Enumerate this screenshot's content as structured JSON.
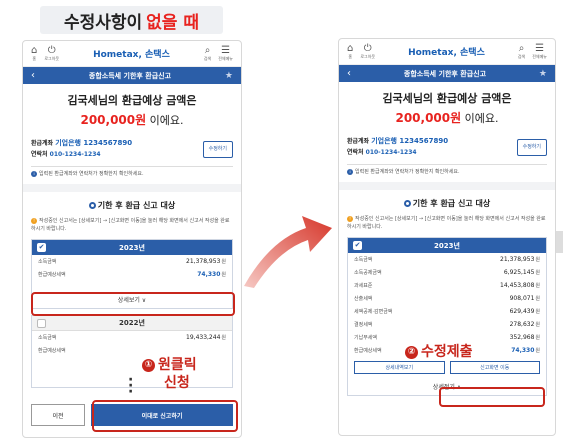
{
  "banner": {
    "text": "수정사항이",
    "highlight": "없을 때"
  },
  "app": {
    "home_label": "홈",
    "login_label": "로그아웃",
    "logo": "Hometax, 손택스",
    "search_label": "검색",
    "menu_label": "전체메뉴",
    "nav_title": "종합소득세 기한후 환급신고"
  },
  "greeting": {
    "name": "김국세",
    "line1": "님의 환급예상 금액은",
    "amount": "200,000원",
    "suffix": " 이에요."
  },
  "account": {
    "label_bank": "환급계좌",
    "bank": "기업은행 1234567890",
    "label_phone": "연락처",
    "phone": "010-1234-1234",
    "edit_btn": "수정하기",
    "notice": "입력된 환급계좌와 연락처가 정확한지 확인하세요."
  },
  "section": {
    "title": "기한 후 환급 신고 대상",
    "guide": "작성중인 신고서는 [상세보기] → [신고화면 이동]을 눌러 해당 화면에서 신고서 작성을 완료하시기 바랍니다."
  },
  "phone1": {
    "card1": {
      "year": "2023년",
      "rows": [
        {
          "label": "소득금액",
          "value": "21,378,953",
          "unit": "원"
        },
        {
          "label": "환급예상세액",
          "value": "74,330",
          "unit": "원"
        }
      ],
      "more": "상세보기 ∨"
    },
    "card2": {
      "year": "2022년",
      "rows": [
        {
          "label": "소득금액",
          "value": "19,433,244",
          "unit": "원"
        },
        {
          "label": "환급예상세액",
          "value": "",
          "unit": ""
        }
      ]
    },
    "btn_prev": "이전",
    "btn_submit": "이대로 신고하기"
  },
  "phone2": {
    "card1": {
      "year": "2023년",
      "rows": [
        {
          "label": "소득금액",
          "value": "21,378,953",
          "unit": "원"
        },
        {
          "label": "소득공제금액",
          "value": "6,925,145",
          "unit": "원"
        },
        {
          "label": "과세표준",
          "value": "14,453,808",
          "unit": "원"
        },
        {
          "label": "산출세액",
          "value": "908,071",
          "unit": "원"
        },
        {
          "label": "세액공제·감면금액",
          "value": "629,439",
          "unit": "원"
        },
        {
          "label": "결정세액",
          "value": "278,632",
          "unit": "원"
        },
        {
          "label": "기납부세액",
          "value": "352,968",
          "unit": "원"
        },
        {
          "label": "환급예상세액",
          "value": "74,330",
          "unit": "원"
        }
      ],
      "btn_detail": "상세내역보기",
      "btn_move": "신고화면 이동",
      "collapse": "상세접기 ∧"
    }
  },
  "annotations": {
    "a1_num": "①",
    "a1_line1": "원클릭",
    "a1_line2": "신청",
    "a2_num": "②",
    "a2_text": "수정제출"
  },
  "colors": {
    "accent": "#2b5ea8",
    "highlight_red": "#c8261c",
    "amount_red": "#e8231f"
  }
}
